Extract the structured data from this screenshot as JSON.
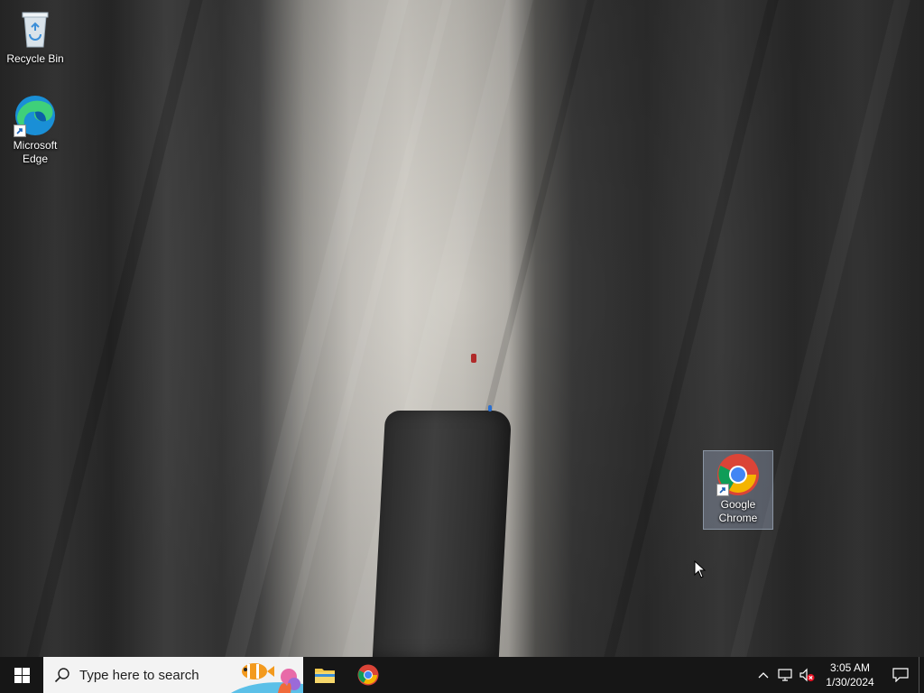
{
  "desktop": {
    "icons": [
      {
        "label": "Recycle Bin",
        "icon": "recycle-bin-icon"
      },
      {
        "label": "Microsoft Edge",
        "icon": "edge-icon"
      },
      {
        "label": "Google Chrome",
        "icon": "chrome-icon",
        "selected": true
      }
    ]
  },
  "taskbar": {
    "search": {
      "placeholder": "Type here to search"
    },
    "pinned_apps": [
      {
        "name": "File Explorer",
        "icon": "folder-icon"
      },
      {
        "name": "Google Chrome",
        "icon": "chrome-icon"
      }
    ],
    "tray": {
      "icons": [
        "chevron-up-icon",
        "network-icon",
        "volume-muted-icon"
      ],
      "time": "3:05 AM",
      "date": "1/30/2024"
    }
  },
  "colors": {
    "taskbar_bg": "#161616",
    "search_bg": "#f3f3f3",
    "windows_blue": "#0078d7",
    "chrome_red": "#db4437",
    "chrome_yellow": "#f4b400",
    "chrome_green": "#0f9d58",
    "chrome_blue": "#4285f4"
  }
}
